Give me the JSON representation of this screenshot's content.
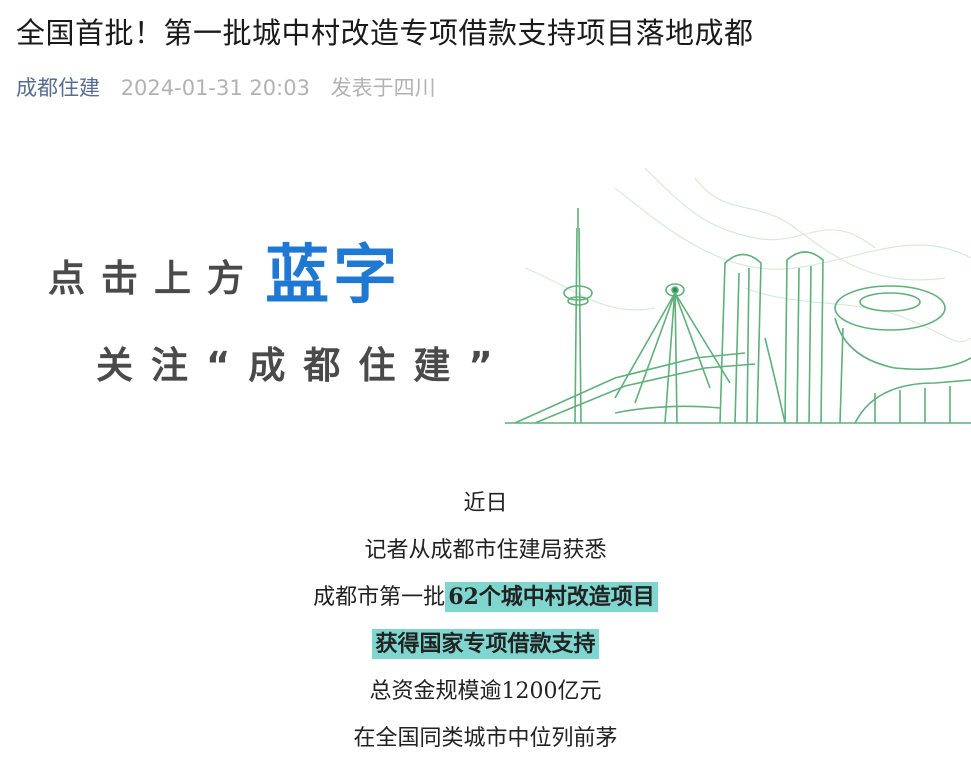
{
  "article": {
    "title": "全国首批！第一批城中村改造专项借款支持项目落地成都",
    "author": "成都住建",
    "date": "2024-01-31 20:03",
    "location": "发表于四川"
  },
  "banner": {
    "line1_prefix": "点击上方",
    "line1_highlight": "蓝字",
    "line2": "关注“成都住建”"
  },
  "body": {
    "p1": "近日",
    "p2": "记者从成都市住建局获悉",
    "p3_prefix": "成都市第一批",
    "p3_highlight": "62个城中村改造项目",
    "p4_highlight": "获得国家专项借款支持",
    "p5": "总资金规模逾1200亿元",
    "p6": "在全国同类城市中位列前茅"
  },
  "colors": {
    "author_link": "#576b95",
    "meta_gray": "#b2b2b2",
    "banner_blue": "#1f78d1",
    "highlight": "#7fd6cf",
    "skyline_green": "#5fb07a"
  }
}
